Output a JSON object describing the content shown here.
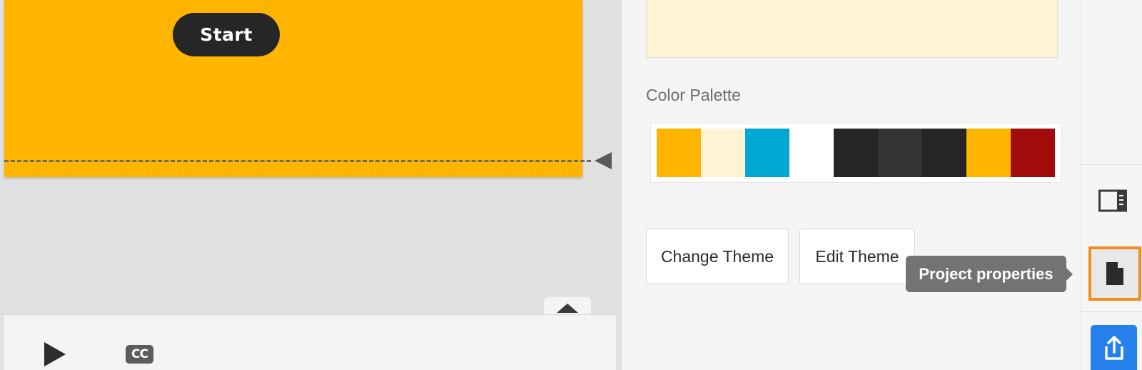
{
  "slide": {
    "start_label": "Start",
    "background_color": "#ffb400"
  },
  "timeline": {
    "cc_label": "CC"
  },
  "panel": {
    "palette_label": "Color Palette",
    "palette_colors": [
      "#ffb400",
      "#fff3d6",
      "#00a8d2",
      "#ffffff",
      "#262626",
      "#333333",
      "#262626",
      "#ffb400",
      "#a10b0b"
    ],
    "change_theme_label": "Change Theme",
    "edit_theme_label": "Edit Theme"
  },
  "tooltip": {
    "text": "Project properties"
  },
  "rail": {
    "icons": [
      "layout-panel-icon",
      "document-icon",
      "publish-icon"
    ],
    "accent_color": "#f08e1c",
    "publish_color": "#2680eb"
  }
}
